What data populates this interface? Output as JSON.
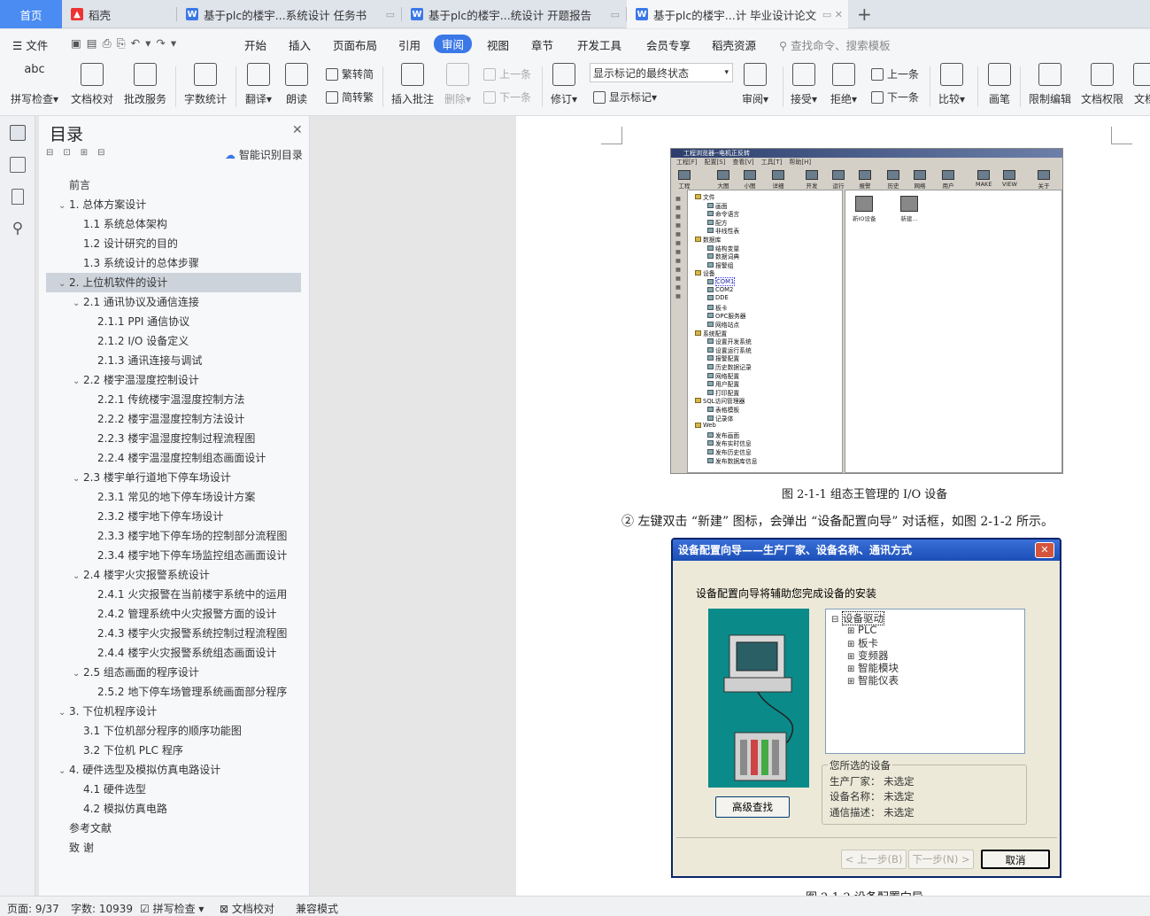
{
  "tabs": [
    {
      "label": "首页"
    },
    {
      "label": "稻壳"
    },
    {
      "label": "基于plc的楼宇...系统设计 任务书"
    },
    {
      "label": "基于plc的楼宇...统设计 开题报告"
    },
    {
      "label": "基于plc的楼宇...计 毕业设计论文"
    }
  ],
  "new_tab": "+",
  "menu": {
    "file": "文件",
    "items": [
      "开始",
      "插入",
      "页面布局",
      "引用",
      "审阅",
      "视图",
      "章节",
      "开发工具",
      "会员专享",
      "稻壳资源"
    ],
    "active": "审阅",
    "search": "查找命令、搜索模板"
  },
  "ribbon": {
    "spell": "拼写检查",
    "proofread": "文档校对",
    "batch": "批改服务",
    "wordcount": "字数统计",
    "translate": "翻译",
    "read": "朗读",
    "trad": "繁转简",
    "simp": "简转繁",
    "insert_comment": "插入批注",
    "delete": "删除",
    "prev": "上一条",
    "next": "下一条",
    "revise": "修订",
    "markup_select": "显示标记的最终状态",
    "show_markup": "显示标记",
    "review": "审阅",
    "accept": "接受",
    "reject": "拒绝",
    "prev2": "上一条",
    "next2": "下一条",
    "compare": "比较",
    "pen": "画笔",
    "restrict": "限制编辑",
    "perm": "文档权限",
    "more": "文档"
  },
  "toc": {
    "title": "目录",
    "smart": "智能识别目录",
    "items": [
      {
        "text": "前言",
        "level": 0,
        "caret": false
      },
      {
        "text": "1.  总体方案设计",
        "level": 0,
        "caret": true
      },
      {
        "text": "1.1  系统总体架构",
        "level": 1,
        "caret": false
      },
      {
        "text": "1.2  设计研究的目的",
        "level": 1,
        "caret": false
      },
      {
        "text": "1.3  系统设计的总体步骤",
        "level": 1,
        "caret": false
      },
      {
        "text": "2.  上位机软件的设计",
        "level": 0,
        "caret": true,
        "selected": true
      },
      {
        "text": "2.1  通讯协议及通信连接",
        "level": 1,
        "caret": true
      },
      {
        "text": "2.1.1 PPI 通信协议",
        "level": 2,
        "caret": false
      },
      {
        "text": "2.1.2 I/O 设备定义",
        "level": 2,
        "caret": false
      },
      {
        "text": "2.1.3  通讯连接与调试",
        "level": 2,
        "caret": false
      },
      {
        "text": "2.2  楼宇温湿度控制设计",
        "level": 1,
        "caret": true
      },
      {
        "text": "2.2.1  传统楼宇温湿度控制方法",
        "level": 2,
        "caret": false
      },
      {
        "text": "2.2.2  楼宇温湿度控制方法设计",
        "level": 2,
        "caret": false
      },
      {
        "text": "2.2.3  楼宇温湿度控制过程流程图",
        "level": 2,
        "caret": false
      },
      {
        "text": "2.2.4  楼宇温湿度控制组态画面设计",
        "level": 2,
        "caret": false
      },
      {
        "text": "2.3  楼宇单行道地下停车场设计",
        "level": 1,
        "caret": true
      },
      {
        "text": "2.3.1  常见的地下停车场设计方案",
        "level": 2,
        "caret": false
      },
      {
        "text": "2.3.2  楼宇地下停车场设计",
        "level": 2,
        "caret": false
      },
      {
        "text": "2.3.3  楼宇地下停车场的控制部分流程图",
        "level": 2,
        "caret": false
      },
      {
        "text": "2.3.4  楼宇地下停车场监控组态画面设计",
        "level": 2,
        "caret": false
      },
      {
        "text": "2.4  楼宇火灾报警系统设计",
        "level": 1,
        "caret": true
      },
      {
        "text": "2.4.1  火灾报警在当前楼宇系统中的运用",
        "level": 2,
        "caret": false
      },
      {
        "text": "2.4.2  管理系统中火灾报警方面的设计",
        "level": 2,
        "caret": false
      },
      {
        "text": "2.4.3  楼宇火灾报警系统控制过程流程图",
        "level": 2,
        "caret": false
      },
      {
        "text": "2.4.4  楼宇火灾报警系统组态画面设计",
        "level": 2,
        "caret": false
      },
      {
        "text": "2.5  组态画面的程序设计",
        "level": 1,
        "caret": true
      },
      {
        "text": "2.5.2  地下停车场管理系统画面部分程序",
        "level": 2,
        "caret": false
      },
      {
        "text": "3.  下位机程序设计",
        "level": 0,
        "caret": true
      },
      {
        "text": "3.1  下位机部分程序的顺序功能图",
        "level": 1,
        "caret": false
      },
      {
        "text": "3.2  下位机 PLC 程序",
        "level": 1,
        "caret": false
      },
      {
        "text": "4.  硬件选型及模拟仿真电路设计",
        "level": 0,
        "caret": true
      },
      {
        "text": "4.1  硬件选型",
        "level": 1,
        "caret": false
      },
      {
        "text": "4.2  模拟仿真电路",
        "level": 1,
        "caret": false
      },
      {
        "text": "参考文献",
        "level": 0,
        "caret": false
      },
      {
        "text": "致    谢",
        "level": 0,
        "caret": false
      }
    ]
  },
  "doc": {
    "fig1_caption": "图 2-1-1  组态王管理的 I/O 设备",
    "para": "②  左键双击 “新建” 图标，会弹出 “设备配置向导” 对话框，如图 2-1-2 所示。",
    "fig2_caption": "图 2-1-2  设备配置向导",
    "fig1": {
      "title": "工程浏览器--电机正反转",
      "menus": [
        "工程[F]",
        "配置[S]",
        "查看[V]",
        "工具[T]",
        "帮助[H]"
      ],
      "toolbar": [
        "工程",
        "大图",
        "小图",
        "详细",
        "开发",
        "运行",
        "报警",
        "历史",
        "网络",
        "用户",
        "MAKE",
        "VIEW",
        "关于"
      ],
      "tree": [
        "文件",
        "画面",
        "命令语言",
        "配方",
        "非线性表",
        "数据库",
        "结构变量",
        "数据词典",
        "报警组",
        "设备",
        "COM1",
        "COM2",
        "DDE",
        "板卡",
        "OPC服务器",
        "网络站点",
        "系统配置",
        "设置开发系统",
        "设置运行系统",
        "报警配置",
        "历史数据记录",
        "网络配置",
        "用户配置",
        "打印配置",
        "SQL访问管理器",
        "表格模板",
        "记录体",
        "Web",
        "发布画面",
        "发布实时信息",
        "发布历史信息",
        "发布数据库信息"
      ],
      "icons": [
        "新IO设备",
        "新建..."
      ]
    },
    "fig2": {
      "title": "设备配置向导——生产厂家、设备名称、通讯方式",
      "intro": "设备配置向导将辅助您完成设备的安装",
      "root": "设备驱动",
      "nodes": [
        "PLC",
        "板卡",
        "变频器",
        "智能模块",
        "智能仪表"
      ],
      "group": "您所选的设备",
      "maker_label": "生产厂家：",
      "maker_val": "未选定",
      "name_label": "设备名称：",
      "name_val": "未选定",
      "comm_label": "通信描述：",
      "comm_val": "未选定",
      "advanced": "高级查找",
      "prev": "< 上一步(B)",
      "next": "下一步(N) >",
      "cancel": "取消"
    }
  },
  "status": {
    "page": "页面: 9/37",
    "words": "字数: 10939",
    "spell": "拼写检查",
    "proof": "文档校对",
    "compat": "兼容模式"
  },
  "colors": {
    "accent": "#3b78e7",
    "home_tab": "#4a8cf2",
    "dialog_title": "#1c4fb8"
  }
}
